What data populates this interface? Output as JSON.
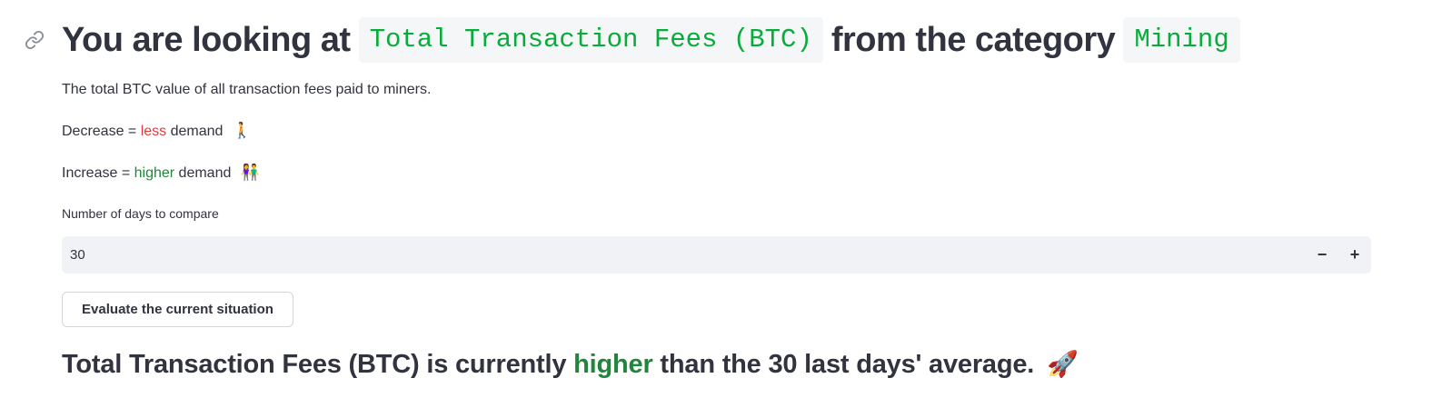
{
  "header": {
    "title_prefix": "You are looking at",
    "metric_name": "Total Transaction Fees (BTC)",
    "title_middle": "from the category",
    "category": "Mining"
  },
  "description": "The total BTC value of all transaction fees paid to miners.",
  "decrease_line": {
    "prefix": "Decrease =",
    "keyword": "less",
    "suffix": "demand",
    "emoji": "🚶"
  },
  "increase_line": {
    "prefix": "Increase =",
    "keyword": "higher",
    "suffix": "demand",
    "emoji": "👫"
  },
  "days_input": {
    "label": "Number of days to compare",
    "value": "30",
    "decrement_label": "−",
    "increment_label": "+"
  },
  "evaluate_button": {
    "label": "Evaluate the current situation"
  },
  "result": {
    "subject": "Total Transaction Fees (BTC) is currently",
    "trend": "higher",
    "tail": "than the 30 last days' average.",
    "emoji": "🚀"
  },
  "colors": {
    "code_text": "#09ab3b",
    "less": "#e03c3c",
    "higher": "#21863b",
    "input_bg": "#f0f2f6"
  }
}
